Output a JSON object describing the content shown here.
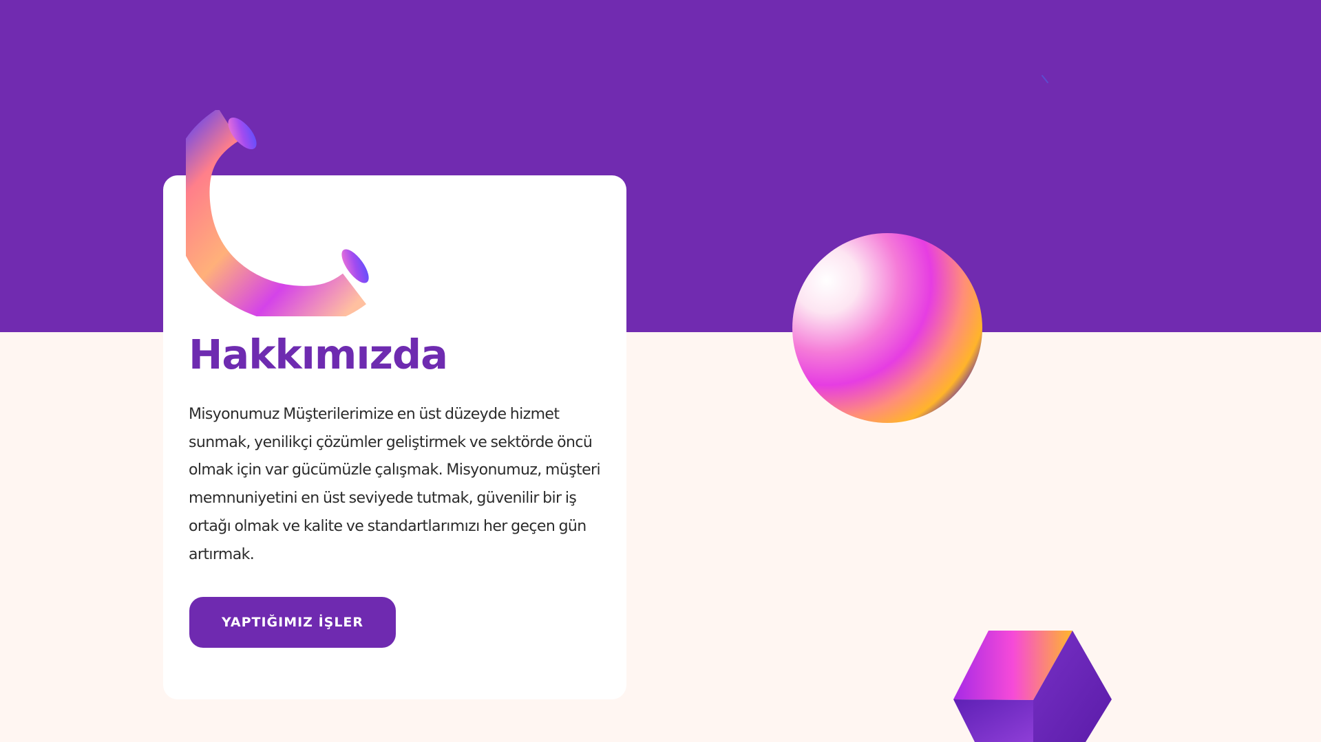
{
  "about": {
    "heading": "Hakkımızda",
    "paragraph": "Misyonumuz Müşterilerimize en üst düzeyde hizmet sunmak, yenilikçi çözümler geliştirmek ve sektörde öncü olmak için var gücümüzle çalışmak. Misyonumuz, müşteri memnuniyetini en üst seviyede tutmak, güvenilir bir iş ortağı olmak ve kalite ve standartlarımızı her geçen gün artırmak.",
    "cta_label": "YAPTIĞIMIZ İŞLER"
  },
  "icons": {
    "ring": "torus-icon",
    "sphere": "gradient-sphere-icon",
    "cube": "cube-icon",
    "dot": "decorative-dot-icon"
  },
  "colors": {
    "primary": "#712bb0",
    "background": "#fff6f2",
    "card": "#ffffff",
    "heading": "#6e2bb0",
    "text": "#2b2b2b",
    "button": "#6f2ab0",
    "button_text": "#ffffff"
  }
}
